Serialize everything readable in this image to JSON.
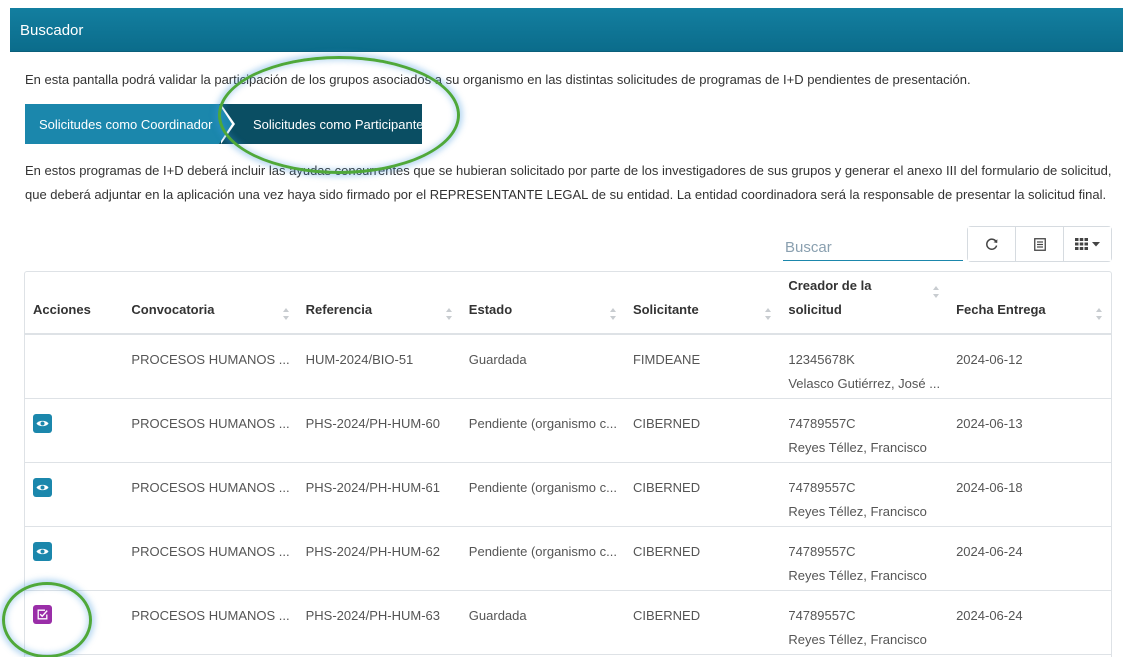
{
  "header": {
    "title": "Buscador"
  },
  "intro_text": "En esta pantalla podrá validar la participación de los grupos asociados a su organismo en las distintas solicitudes de programas de I+D pendientes de presentación.",
  "tabs": [
    {
      "label": "Solicitudes como Coordinador",
      "active": false
    },
    {
      "label": "Solicitudes como Participante",
      "active": true
    }
  ],
  "description": {
    "line1": "En estos programas de I+D deberá incluir las ayudas concurrentes que se hubieran solicitado por parte de los investigadores de sus grupos y generar el anexo III del formulario de solicitud,",
    "line2": "que deberá adjuntar en la aplicación una vez haya sido firmado por el REPRESENTANTE LEGAL de su entidad. La entidad coordinadora será la responsable de presentar la solicitud final."
  },
  "search": {
    "placeholder": "Buscar",
    "value": ""
  },
  "toolbar": {
    "icons": [
      "refresh-icon",
      "list-icon",
      "columns-icon"
    ]
  },
  "table": {
    "columns": {
      "acciones": "Acciones",
      "convocatoria": "Convocatoria",
      "referencia": "Referencia",
      "estado": "Estado",
      "solicitante": "Solicitante",
      "creador_line1": "Creador de la",
      "creador_line2": "solicitud",
      "fecha": "Fecha Entrega"
    },
    "rows": [
      {
        "action": "",
        "convocatoria": "PROCESOS HUMANOS ...",
        "referencia": "HUM-2024/BIO-51",
        "estado": "Guardada",
        "solicitante": "FIMDEANE",
        "creador_id": "12345678K",
        "creador_name": "Velasco Gutiérrez, José ...",
        "fecha": "2024-06-12"
      },
      {
        "action": "view",
        "convocatoria": "PROCESOS HUMANOS ...",
        "referencia": "PHS-2024/PH-HUM-60",
        "estado": "Pendiente (organismo c...",
        "solicitante": "CIBERNED",
        "creador_id": "74789557C",
        "creador_name": "Reyes Téllez, Francisco",
        "fecha": "2024-06-13"
      },
      {
        "action": "view",
        "convocatoria": "PROCESOS HUMANOS ...",
        "referencia": "PHS-2024/PH-HUM-61",
        "estado": "Pendiente (organismo c...",
        "solicitante": "CIBERNED",
        "creador_id": "74789557C",
        "creador_name": "Reyes Téllez, Francisco",
        "fecha": "2024-06-18"
      },
      {
        "action": "view",
        "convocatoria": "PROCESOS HUMANOS ...",
        "referencia": "PHS-2024/PH-HUM-62",
        "estado": "Pendiente (organismo c...",
        "solicitante": "CIBERNED",
        "creador_id": "74789557C",
        "creador_name": "Reyes Téllez, Francisco",
        "fecha": "2024-06-24"
      },
      {
        "action": "edit",
        "convocatoria": "PROCESOS HUMANOS ...",
        "referencia": "PHS-2024/PH-HUM-63",
        "estado": "Guardada",
        "solicitante": "CIBERNED",
        "creador_id": "74789557C",
        "creador_name": "Reyes Téllez, Francisco",
        "fecha": "2024-06-24"
      }
    ]
  },
  "colors": {
    "primary": "#1b87ac",
    "dark": "#0a4e63",
    "edit": "#9a2ea8",
    "highlight": "#4fa83a"
  }
}
